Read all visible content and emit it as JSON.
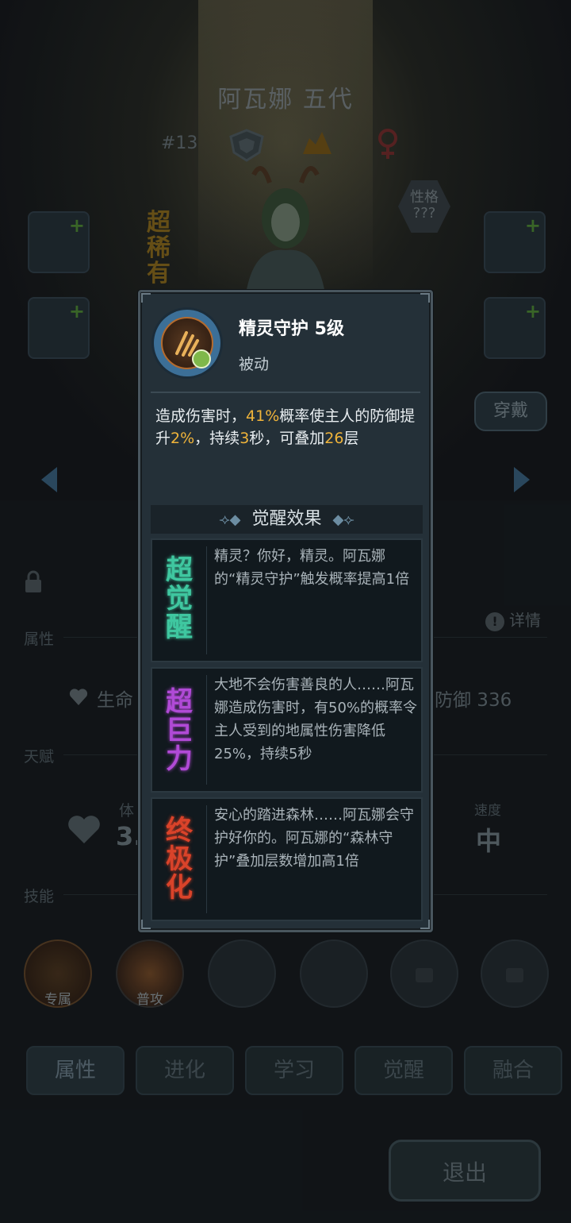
{
  "hero": {
    "name": "阿瓦娜 五代",
    "number": "#13",
    "rarity": "超稀有",
    "personality": "性格\n???"
  },
  "buttons": {
    "wear": "穿戴",
    "exit": "退出"
  },
  "sections": {
    "attributes": "属性",
    "talent": "天赋",
    "skills": "技能",
    "details": "详情"
  },
  "stats": {
    "hp_label": "生命",
    "defense": "防御 336",
    "stamina_label": "体",
    "stamina_value": "3.",
    "speed_label": "速度",
    "speed_value": "中"
  },
  "skill_slots": [
    {
      "label": "专属"
    },
    {
      "label": "普攻"
    }
  ],
  "tabs": [
    "属性",
    "进化",
    "学习",
    "觉醒",
    "融合"
  ],
  "modal": {
    "title": "精灵守护 5级",
    "type": "被动",
    "desc": {
      "p1": "造成伤害时，",
      "v1": "41%",
      "p2": "概率使主人的防御提升",
      "v2": "2%",
      "p3": "，持续",
      "v3": "3",
      "p4": "秒，可叠加",
      "v4": "26",
      "p5": "层"
    },
    "awakening_header": "觉醒效果",
    "awakenings": [
      {
        "badge": "超觉醒",
        "text": "精灵？你好，精灵。阿瓦娜的“精灵守护”触发概率提高1倍",
        "color": "#3fc7a0"
      },
      {
        "badge": "超巨力",
        "text": "大地不会伤害善良的人……阿瓦娜造成伤害时，有50%的概率令主人受到的地属性伤害降低25%，持续5秒",
        "color": "#b04ad6"
      },
      {
        "badge": "终极化",
        "text": "安心的踏进森林……阿瓦娜会守护好你的。阿瓦娜的“森林守护”叠加层数增加高1倍",
        "color": "#d9432a"
      }
    ]
  }
}
